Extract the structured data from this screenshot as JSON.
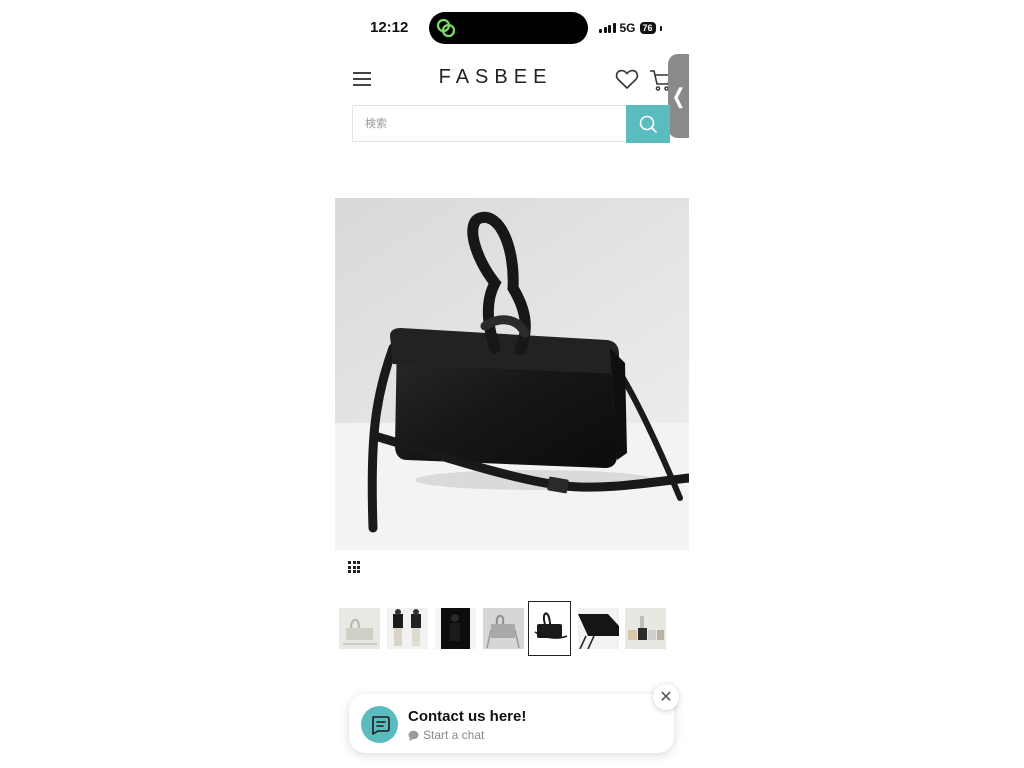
{
  "status_bar": {
    "time": "12:12",
    "network": "5G",
    "battery": "76"
  },
  "header": {
    "logo": "FASBEE",
    "icons": [
      "menu-icon",
      "heart-icon",
      "cart-icon",
      "chevron-left-icon"
    ],
    "side_tab_glyph": "❬"
  },
  "search": {
    "placeholder": "検索",
    "button_icon": "search-icon",
    "accent_color": "#5bbcbf"
  },
  "product": {
    "main_image": "black-leather-handbag-with-knotted-handle",
    "thumbnails": [
      "silver-bag-thumbnail",
      "model-thumbnail",
      "model-dark-thumbnail",
      "silver-bag-strap-thumbnail",
      "black-bag-thumbnail",
      "black-bag-detail-thumbnail",
      "color-variants-thumbnail"
    ],
    "selected_thumbnail_index": 4
  },
  "chat": {
    "title": "Contact us here!",
    "subtitle": "Start a chat",
    "close_glyph": "✕",
    "avatar_icon": "chat-icon"
  }
}
